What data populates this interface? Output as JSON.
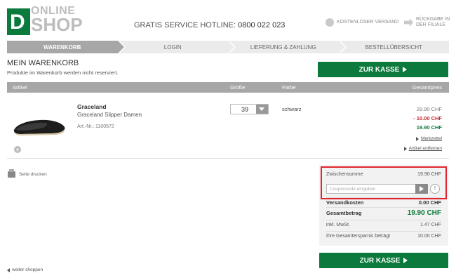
{
  "header": {
    "logo_letter": "D",
    "logo_top": "ONLINE",
    "logo_bottom": "SHOP",
    "hotline_label": "GRATIS SERVICE HOTLINE:",
    "hotline_number": "0800 022 023",
    "service_shipping": "KOSTENLOSER VERSAND",
    "service_return": "RÜCKGABE IN DER FILIALE"
  },
  "steps": [
    {
      "label": "WARENKORB",
      "active": true
    },
    {
      "label": "LOGIN",
      "active": false
    },
    {
      "label": "LIEFERUNG & ZAHLUNG",
      "active": false
    },
    {
      "label": "BESTELLÜBERSICHT",
      "active": false
    }
  ],
  "page": {
    "title": "MEIN WARENKORB",
    "subtitle": "Produkte im Warenkorb werden nicht reserviert.",
    "checkout_label": "ZUR KASSE"
  },
  "table": {
    "col_article": "Artikel",
    "col_size": "Größe",
    "col_color": "Farbe",
    "col_total": "Gesamtpreis"
  },
  "product": {
    "brand": "Graceland",
    "name": "Graceland Slipper Damen",
    "article_no": "Art.-Nr.: 1100572",
    "size": "39",
    "color": "schwarz",
    "price_original": "29.90 CHF",
    "price_discount": "- 10.00 CHF",
    "price_final": "19.90 CHF",
    "link_watchlist": "Merkzettel",
    "link_remove": "Artikel entfernen"
  },
  "print_label": "Seite drucken",
  "summary": {
    "subtotal_label": "Zwischensumme",
    "subtotal_value": "19.90 CHF",
    "coupon_placeholder": "Couponcode eingeben",
    "shipping_label": "Versandkosten",
    "shipping_value": "0.00 CHF",
    "total_label": "Gesamtbetrag",
    "total_value": "19.90 CHF",
    "vat_label": "inkl. MwSt.",
    "vat_value": "1.47 CHF",
    "savings_label": "Ihre Gesamtersparnis beträgt",
    "savings_value": "10.00 CHF"
  },
  "continue_shopping": "weiter shoppen",
  "colors": {
    "brand_green": "#0b7a3c",
    "discount_red": "#c1272d",
    "highlight_red": "#e3262e",
    "header_gray": "#a7a7a7"
  },
  "icons": {
    "shipping": "truck-circle-icon",
    "return": "return-arrow-icon",
    "size_dropdown": "chevron-down-icon",
    "add": "plus-circle-icon",
    "print": "printer-icon",
    "coupon_submit": "play-arrow-icon",
    "info": "info-icon"
  }
}
